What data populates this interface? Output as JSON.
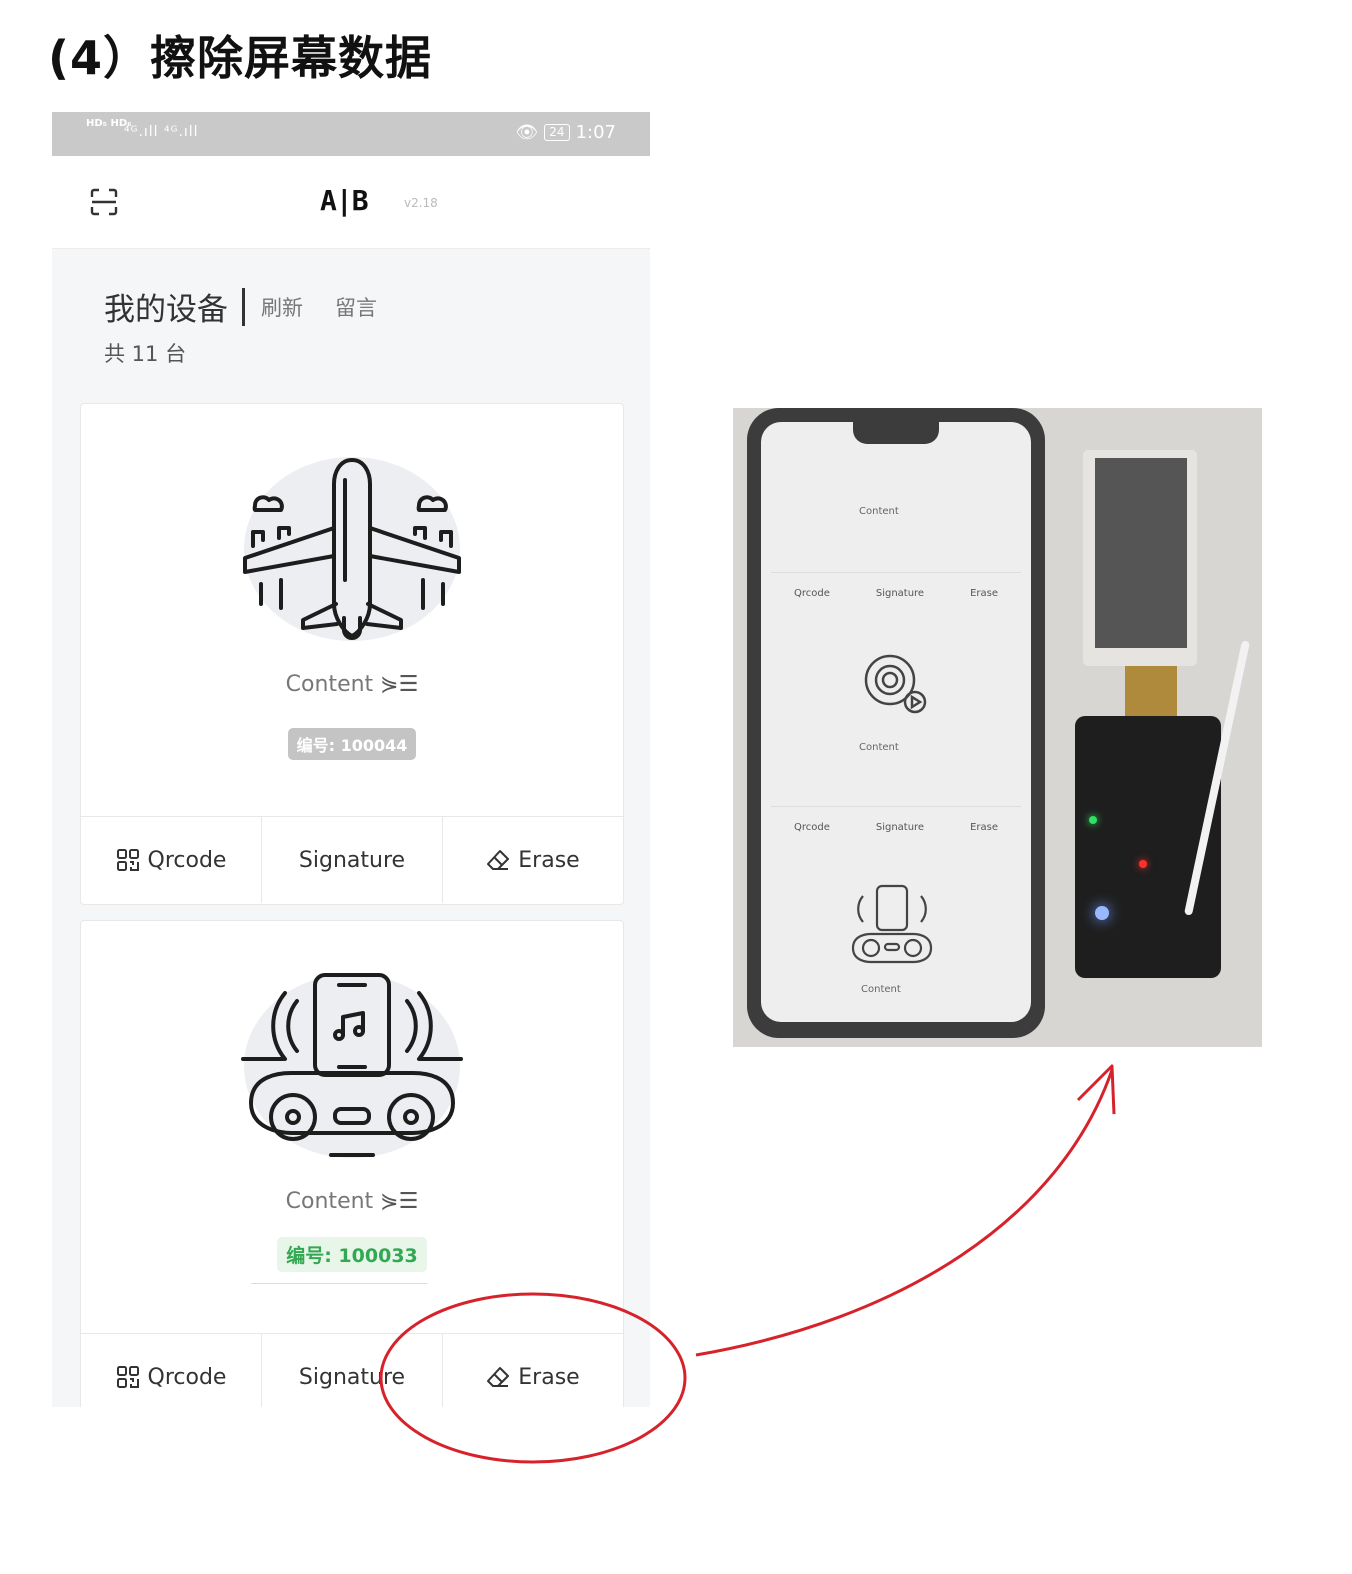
{
  "heading": "(4）擦除屏幕数据",
  "status_bar": {
    "left_badges": "HD₅ HD₆",
    "signal": "⁴ᴳ.ıll ⁴ᴳ.ıll",
    "battery": "24",
    "time": "1:07"
  },
  "app_bar": {
    "logo": "A|B",
    "version": "v2.18"
  },
  "devices_header": {
    "title": "我的设备",
    "refresh": "刷新",
    "message": "留言",
    "count": "共 11 台"
  },
  "cards": [
    {
      "illustration": "airplane-icon",
      "content_label": "Content",
      "id_badge": "编号: 100044",
      "actions": [
        "Qrcode",
        "Signature",
        "Erase"
      ]
    },
    {
      "illustration": "phone-music-speaker-icon",
      "content_label": "Content",
      "id_badge": "编号: 100033",
      "actions": [
        "Qrcode",
        "Signature",
        "Erase"
      ]
    }
  ],
  "photo": {
    "content_label": "Content",
    "actions": [
      "Qrcode",
      "Signature",
      "Erase"
    ]
  },
  "colors": {
    "annotation": "#d6222b",
    "online_badge": "#33a852",
    "offline_badge": "#c4c4c4"
  }
}
